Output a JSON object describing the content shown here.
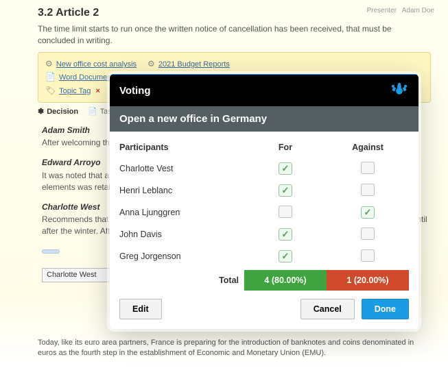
{
  "page": {
    "title": "3.2 Article 2",
    "presenter_label": "Presenter",
    "presenter_name": "Adam Doe",
    "intro": "The time limit starts to run once the written notice of cancellation has been received, that must be concluded in writing.",
    "attachments": {
      "row1": [
        "New office cost analysis",
        "2021 Budget Reports"
      ],
      "row2": [
        "Word Document"
      ],
      "row3": [
        "Topic Tag"
      ]
    },
    "tabs": [
      "Decision",
      "Tasks"
    ],
    "minutes": [
      {
        "name": "Adam Smith",
        "text": "After welcoming the new members of the committee, the chair opened the discussion."
      },
      {
        "name": "Edward Arroyo",
        "text": "It was noted that a large number of the elements had no figures specified and the color for B2MML elements was retained. It was also noted that the agreed color for B2MML elements was retained."
      },
      {
        "name": "Charlotte West",
        "text": "Recommends that if the task group is unable to meet, then the proposed changes should be deferred until after the winter. After brief discussion, it was agreed to defer any changes."
      }
    ],
    "chip": " ",
    "select_value": "Charlotte West",
    "footer": "Today, like its euro area partners, France is preparing for the introduction of banknotes and coins denominated in euros as the fourth step in the establishment of Economic and Monetary Union (EMU)."
  },
  "modal": {
    "title": "Voting",
    "subject": "Open a new office in Germany",
    "cols": {
      "participants": "Participants",
      "for": "For",
      "against": "Against"
    },
    "rows": [
      {
        "name": "Charlotte Vest",
        "for": true,
        "against": false
      },
      {
        "name": "Henri Leblanc",
        "for": true,
        "against": false
      },
      {
        "name": "Anna Ljunggren",
        "for": false,
        "against": true
      },
      {
        "name": "John Davis",
        "for": true,
        "against": false
      },
      {
        "name": "Greg Jorgenson",
        "for": true,
        "against": false
      }
    ],
    "totals": {
      "label": "Total",
      "for": "4 (80.00%)",
      "against": "1 (20.00%)"
    },
    "buttons": {
      "edit": "Edit",
      "cancel": "Cancel",
      "done": "Done"
    }
  }
}
